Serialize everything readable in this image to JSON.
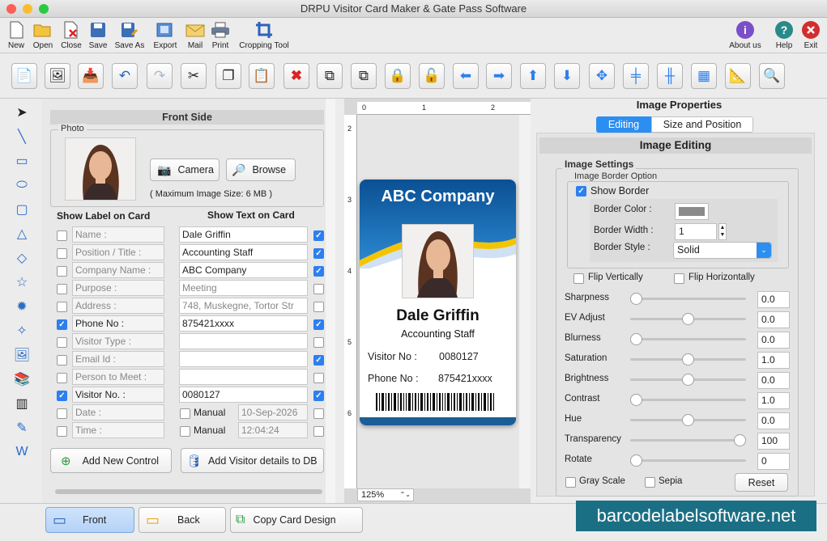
{
  "window": {
    "title": "DRPU Visitor Card Maker & Gate Pass Software"
  },
  "menu": {
    "items": [
      {
        "label": "New",
        "icon": "new-doc-icon"
      },
      {
        "label": "Open",
        "icon": "folder-open-icon"
      },
      {
        "label": "Close",
        "icon": "close-doc-icon"
      },
      {
        "label": "Save",
        "icon": "floppy-icon"
      },
      {
        "label": "Save As",
        "icon": "save-as-icon"
      },
      {
        "label": "Export",
        "icon": "export-icon"
      },
      {
        "label": "Mail",
        "icon": "mail-icon"
      },
      {
        "label": "Print",
        "icon": "printer-icon"
      },
      {
        "label": "Cropping Tool",
        "icon": "crop-icon"
      }
    ],
    "right_items": [
      {
        "label": "About us",
        "icon": "info-icon"
      },
      {
        "label": "Help",
        "icon": "help-icon"
      },
      {
        "label": "Exit",
        "icon": "exit-icon"
      }
    ]
  },
  "front": {
    "header": "Front Side",
    "photo_legend": "Photo",
    "camera_label": "Camera",
    "browse_label": "Browse",
    "max_size": "( Maximum Image Size: 6 MB )",
    "show_label_header": "Show Label on Card",
    "show_text_header": "Show Text on Card",
    "rows": [
      {
        "label": "Name :",
        "value": "Dale Griffin",
        "lcheck": false,
        "rcheck": true
      },
      {
        "label": "Position / Title :",
        "value": "Accounting Staff",
        "lcheck": false,
        "rcheck": true
      },
      {
        "label": "Company Name :",
        "value": "ABC Company",
        "lcheck": false,
        "rcheck": true
      },
      {
        "label": "Purpose :",
        "value": "Meeting",
        "lcheck": false,
        "rcheck": false
      },
      {
        "label": "Address :",
        "value": "748, Muskegne, Tortor Str",
        "lcheck": false,
        "rcheck": false
      },
      {
        "label": "Phone No :",
        "value": "875421xxxx",
        "lcheck": true,
        "rcheck": true
      },
      {
        "label": "Visitor Type :",
        "value": "",
        "lcheck": false,
        "rcheck": false
      },
      {
        "label": "Email Id :",
        "value": "",
        "lcheck": false,
        "rcheck": true
      },
      {
        "label": "Person to Meet :",
        "value": "",
        "lcheck": false,
        "rcheck": false
      },
      {
        "label": "Visitor No. :",
        "value": "0080127",
        "lcheck": true,
        "rcheck": true
      }
    ],
    "date_label": "Date :",
    "time_label": "Time :",
    "manual": "Manual",
    "date_value": "10-Sep-2026",
    "time_value": "12:04:24",
    "add_control": "Add New Control",
    "add_visitor": "Add Visitor details to DB"
  },
  "canvas": {
    "ruler_marks": [
      "0",
      "1",
      "2"
    ],
    "ruler_v_marks": [
      "2",
      "3",
      "4",
      "5",
      "6"
    ],
    "zoom": "125%"
  },
  "card": {
    "company": "ABC Company",
    "name": "Dale Griffin",
    "title": "Accounting Staff",
    "visitor_label": "Visitor No :",
    "visitor_value": "0080127",
    "phone_label": "Phone No :",
    "phone_value": "875421xxxx",
    "colors": {
      "header": "#1561a8",
      "accent": "#f5c400",
      "footer": "#1b5d97"
    }
  },
  "props": {
    "title": "Image Properties",
    "tabs": [
      "Editing",
      "Size and Position"
    ],
    "editing_header": "Image Editing",
    "settings_legend": "Image Settings",
    "border_legend": "Image Border Option",
    "show_border": "Show Border",
    "border_color_label": "Border Color :",
    "border_width_label": "Border Width :",
    "border_width": "1",
    "border_style_label": "Border Style :",
    "border_style": "Solid",
    "flip_v": "Flip Vertically",
    "flip_h": "Flip Horizontally",
    "sliders": [
      {
        "label": "Sharpness",
        "value": "0.0",
        "level": 0.0
      },
      {
        "label": "EV Adjust",
        "value": "0.0",
        "level": 0.5
      },
      {
        "label": "Blurness",
        "value": "0.0",
        "level": 0.0
      },
      {
        "label": "Saturation",
        "value": "1.0",
        "level": 0.5
      },
      {
        "label": "Brightness",
        "value": "0.0",
        "level": 0.5
      },
      {
        "label": "Contrast",
        "value": "1.0",
        "level": 0.0
      },
      {
        "label": "Hue",
        "value": "0.0",
        "level": 0.5
      },
      {
        "label": "Transparency",
        "value": "100",
        "level": 1.0
      },
      {
        "label": "Rotate",
        "value": "0",
        "level": 0.0
      }
    ],
    "grayscale": "Gray Scale",
    "sepia": "Sepia",
    "reset": "Reset"
  },
  "bottom": {
    "front": "Front",
    "back": "Back",
    "copy": "Copy Card Design",
    "watermark": "barcodelabelsoftware.net"
  }
}
